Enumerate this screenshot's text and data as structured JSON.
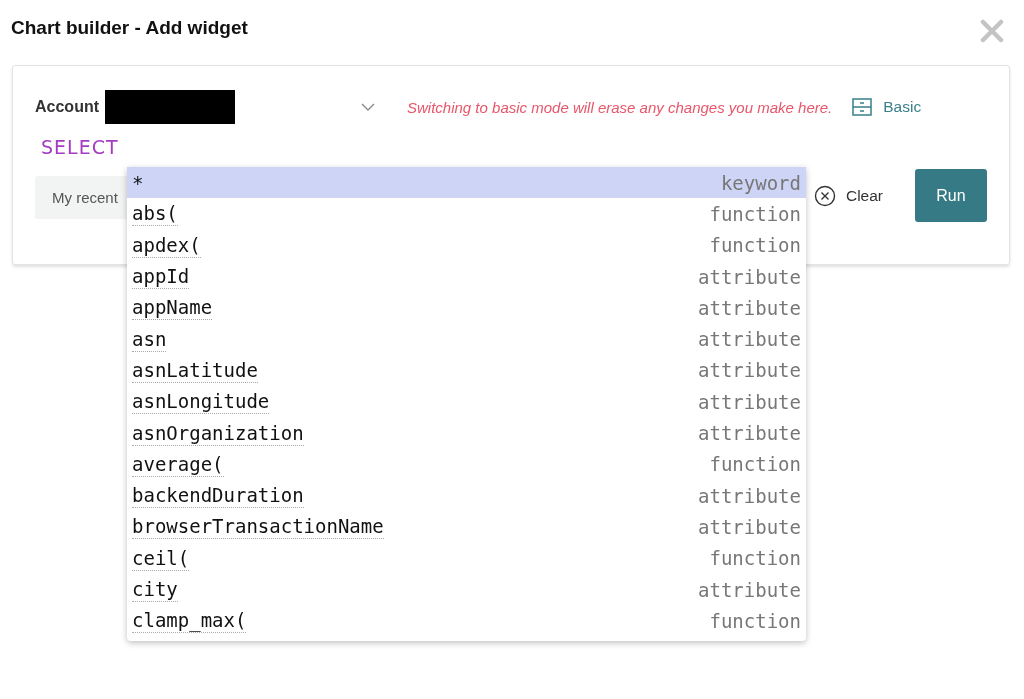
{
  "window": {
    "title": "Chart builder - Add widget"
  },
  "account": {
    "label": "Account"
  },
  "warning": "Switching to basic mode will erase any changes you make here.",
  "mode_button": {
    "label": "Basic"
  },
  "query": {
    "keyword": "SELECT"
  },
  "recent_button": {
    "label": "My recent"
  },
  "clear_button": {
    "label": "Clear"
  },
  "run_button": {
    "label": "Run"
  },
  "suggestions": [
    {
      "label": "*",
      "type": "keyword",
      "selected": true
    },
    {
      "label": "abs(",
      "type": "function",
      "selected": false
    },
    {
      "label": "apdex(",
      "type": "function",
      "selected": false
    },
    {
      "label": "appId",
      "type": "attribute",
      "selected": false
    },
    {
      "label": "appName",
      "type": "attribute",
      "selected": false
    },
    {
      "label": "asn",
      "type": "attribute",
      "selected": false
    },
    {
      "label": "asnLatitude",
      "type": "attribute",
      "selected": false
    },
    {
      "label": "asnLongitude",
      "type": "attribute",
      "selected": false
    },
    {
      "label": "asnOrganization",
      "type": "attribute",
      "selected": false
    },
    {
      "label": "average(",
      "type": "function",
      "selected": false
    },
    {
      "label": "backendDuration",
      "type": "attribute",
      "selected": false
    },
    {
      "label": "browserTransactionName",
      "type": "attribute",
      "selected": false
    },
    {
      "label": "ceil(",
      "type": "function",
      "selected": false
    },
    {
      "label": "city",
      "type": "attribute",
      "selected": false
    },
    {
      "label": "clamp_max(",
      "type": "function",
      "selected": false
    }
  ]
}
